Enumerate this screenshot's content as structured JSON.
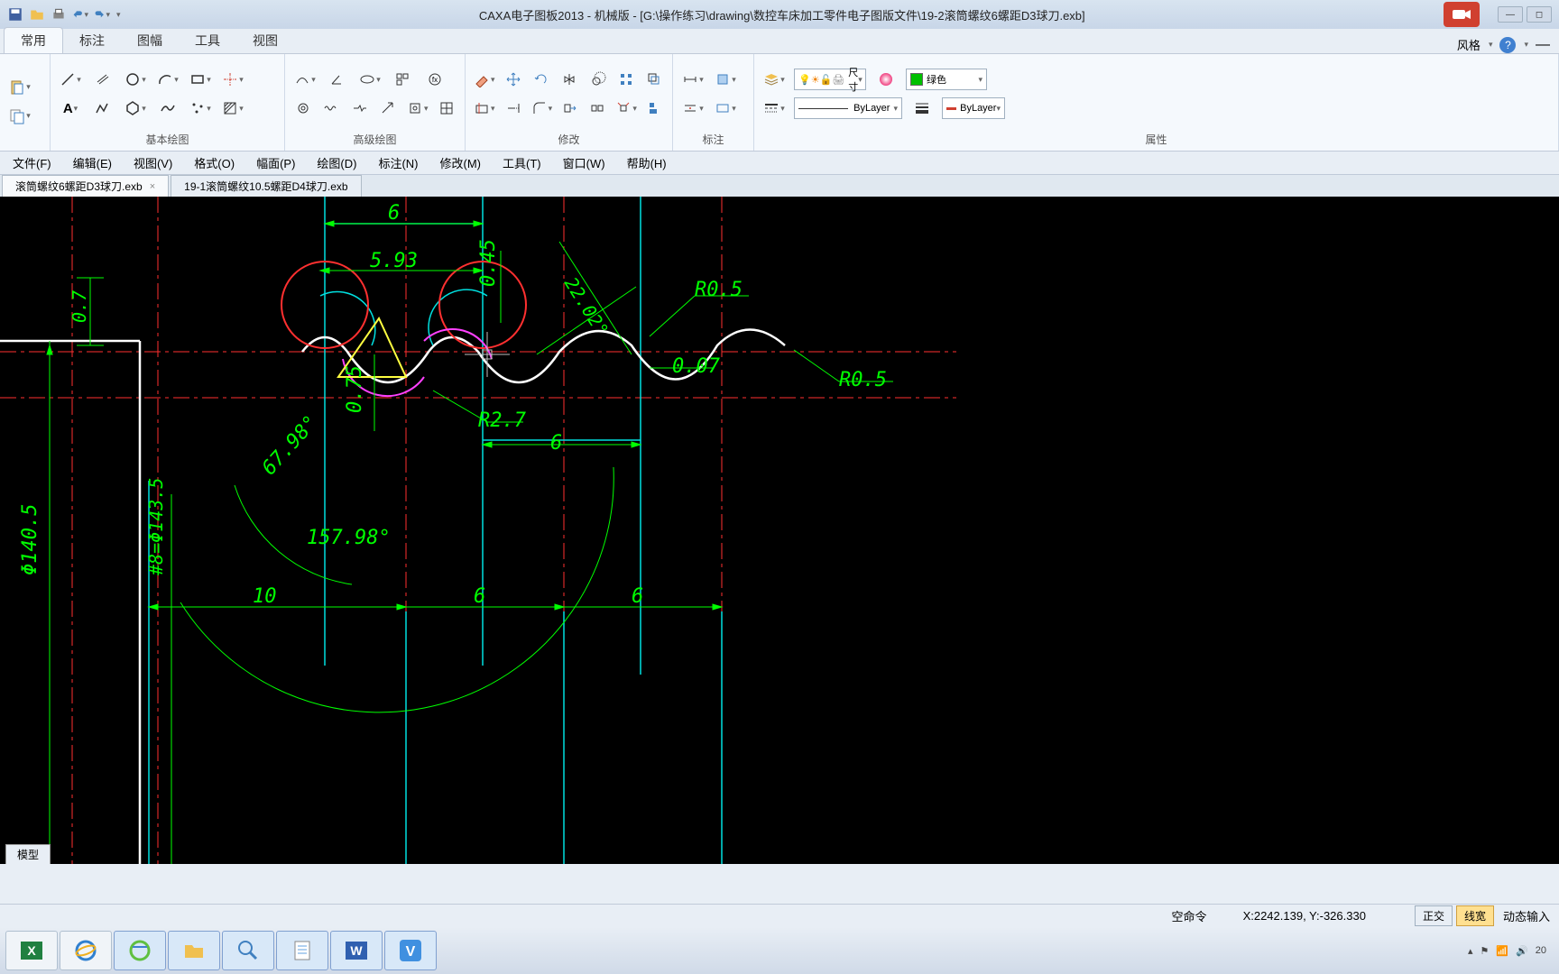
{
  "title": "CAXA电子图板2013 - 机械版 - [G:\\操作练习\\drawing\\数控车床加工零件电子图版文件\\19-2滚筒螺纹6螺距D3球刀.exb]",
  "tabs": {
    "main": [
      "常用",
      "标注",
      "图幅",
      "工具",
      "视图"
    ],
    "style_label": "风格"
  },
  "ribbon": {
    "g1": "基本绘图",
    "g2": "高级绘图",
    "g3": "修改",
    "g4": "标注",
    "g5": "属性",
    "dim_label": "尺寸",
    "color_name": "绿色",
    "bylayer": "ByLayer",
    "bylayer2": "ByLayer"
  },
  "menu": [
    "文件(F)",
    "编辑(E)",
    "视图(V)",
    "格式(O)",
    "幅面(P)",
    "绘图(D)",
    "标注(N)",
    "修改(M)",
    "工具(T)",
    "窗口(W)",
    "帮助(H)"
  ],
  "docs": {
    "tab1": "滚筒螺纹6螺距D3球刀.exb",
    "tab2": "19-1滚筒螺纹10.5螺距D4球刀.exb"
  },
  "model_tab": "模型",
  "dims": {
    "d6a": "6",
    "d593": "5.93",
    "d045": "0.45",
    "d2202": "22.02°",
    "r05a": "R0.5",
    "r05b": "R0.5",
    "d007": "0.07",
    "d075": "0.75",
    "r27": "R2.7",
    "d6b": "6",
    "d6798": "67.98°",
    "d15798": "157.98°",
    "d07": "0.7",
    "phi1405": "Φ140.5",
    "phi1435": "#8=Φ143.5",
    "d10": "10",
    "d6c": "6",
    "d6d": "6"
  },
  "status": {
    "cmd": "空命令",
    "coord": "X:2242.139, Y:-326.330",
    "ortho": "正交",
    "lwt": "线宽",
    "dyn": "动态输入"
  },
  "clock": "20"
}
